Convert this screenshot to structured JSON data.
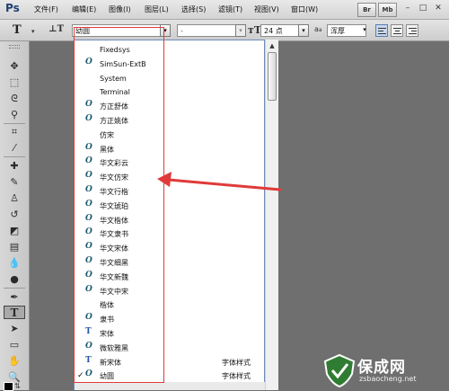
{
  "menubar": {
    "logo": "Ps",
    "items": [
      "文件(F)",
      "编辑(E)",
      "图像(I)",
      "图层(L)",
      "选择(S)",
      "滤镜(T)",
      "视图(V)",
      "窗口(W)"
    ],
    "buttons": [
      "Br",
      "Mb"
    ],
    "window_controls": [
      "–",
      "□",
      "✕"
    ]
  },
  "options": {
    "font_family_value": "幼圆",
    "font_style_value": "-",
    "font_size_value": "24 点",
    "aa_icon_label": "a",
    "antialias_value": "浑厚"
  },
  "font_list": {
    "items": [
      {
        "name": "Fixedsys",
        "icon": "none",
        "sample": ""
      },
      {
        "name": "SimSun-ExtB",
        "icon": "opentype-icon",
        "sample": ""
      },
      {
        "name": "System",
        "icon": "none",
        "sample": ""
      },
      {
        "name": "Terminal",
        "icon": "none",
        "sample": ""
      },
      {
        "name": "方正舒体",
        "icon": "opentype-icon",
        "sample": ""
      },
      {
        "name": "方正姚体",
        "icon": "opentype-icon",
        "sample": ""
      },
      {
        "name": "仿宋",
        "icon": "none",
        "sample": ""
      },
      {
        "name": "黑体",
        "icon": "opentype-icon",
        "sample": ""
      },
      {
        "name": "华文彩云",
        "icon": "opentype-icon",
        "sample": ""
      },
      {
        "name": "华文仿宋",
        "icon": "opentype-icon",
        "sample": ""
      },
      {
        "name": "华文行楷",
        "icon": "opentype-icon",
        "sample": ""
      },
      {
        "name": "华文琥珀",
        "icon": "opentype-icon",
        "sample": ""
      },
      {
        "name": "华文楷体",
        "icon": "opentype-icon",
        "sample": ""
      },
      {
        "name": "华文隶书",
        "icon": "opentype-icon",
        "sample": ""
      },
      {
        "name": "华文宋体",
        "icon": "opentype-icon",
        "sample": ""
      },
      {
        "name": "华文细黑",
        "icon": "opentype-icon",
        "sample": ""
      },
      {
        "name": "华文新魏",
        "icon": "opentype-icon",
        "sample": ""
      },
      {
        "name": "华文中宋",
        "icon": "opentype-icon",
        "sample": ""
      },
      {
        "name": "楷体",
        "icon": "none",
        "sample": ""
      },
      {
        "name": "隶书",
        "icon": "opentype-icon",
        "sample": ""
      },
      {
        "name": "宋体",
        "icon": "truetype-icon",
        "sample": ""
      },
      {
        "name": "微软雅黑",
        "icon": "opentype-icon",
        "sample": ""
      },
      {
        "name": "新宋体",
        "icon": "truetype-icon",
        "sample": "字体样式"
      },
      {
        "name": "幼圆",
        "icon": "opentype-icon",
        "sample": "字体样式",
        "checked": true
      }
    ]
  },
  "annotation": {
    "color": "#e03a3a"
  },
  "watermark": {
    "title": "保成网",
    "subtitle": "zsbaocheng.net"
  }
}
